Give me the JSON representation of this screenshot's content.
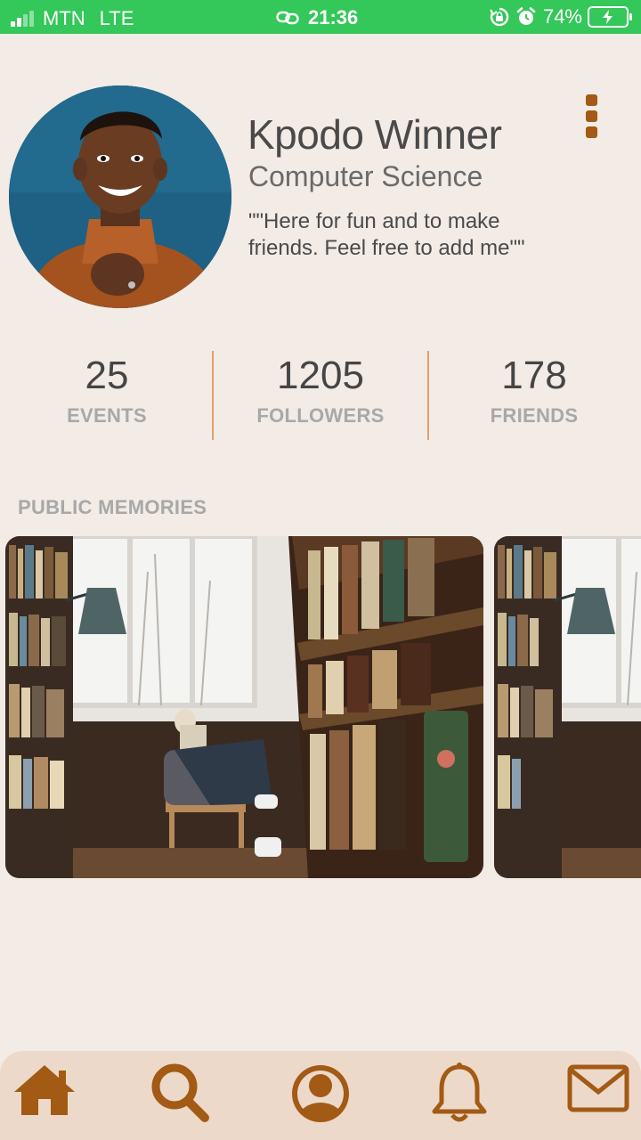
{
  "status_bar": {
    "carrier": "MTN",
    "network": "LTE",
    "time": "21:36",
    "battery": "74%",
    "icons": [
      "signal-icon",
      "link-icon",
      "rotation-lock-icon",
      "alarm-icon",
      "battery-charging-icon"
    ]
  },
  "profile": {
    "name": "Kpodo Winner",
    "department": "Computer Science",
    "bio": "\"\"Here for fun and to make friends. Feel free to add me\"\"",
    "menu_icon": "more-vertical-icon"
  },
  "stats": [
    {
      "value": "25",
      "label": "EVENTS"
    },
    {
      "value": "1205",
      "label": "FOLLOWERS"
    },
    {
      "value": "178",
      "label": "FRIENDS"
    }
  ],
  "section_title": "PUBLIC MEMORIES",
  "nav": {
    "items": [
      "home-icon",
      "search-icon",
      "profile-icon",
      "bell-icon",
      "mail-icon"
    ],
    "accent": "#a25a14"
  },
  "colors": {
    "status_bar": "#34c759",
    "background": "#f2ebe6",
    "accent": "#a25a14",
    "divider": "#e0a06a",
    "nav_background": "#ecd9c9"
  }
}
